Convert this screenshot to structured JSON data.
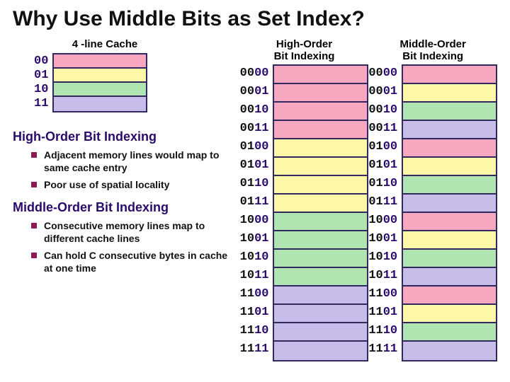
{
  "title": "Why Use Middle Bits as Set Index?",
  "cache": {
    "label": "4 -line Cache",
    "lines": [
      "00",
      "01",
      "10",
      "11"
    ],
    "colors": [
      "c0",
      "c1",
      "c2",
      "c3"
    ]
  },
  "sections": {
    "high": {
      "heading": "High-Order Bit Indexing",
      "bullets": [
        "Adjacent memory lines would map to same cache entry",
        "Poor use of spatial locality"
      ]
    },
    "middle": {
      "heading": "Middle-Order Bit Indexing",
      "bullets": [
        "Consecutive memory lines map to different cache lines",
        "Can hold C consecutive bytes in cache at one time"
      ]
    }
  },
  "columns": {
    "high": {
      "title_line1": "High-Order",
      "title_line2": "Bit Indexing",
      "rows": [
        {
          "bits": "0000",
          "hi": 2,
          "color": "c0"
        },
        {
          "bits": "0001",
          "hi": 2,
          "color": "c0"
        },
        {
          "bits": "0010",
          "hi": 2,
          "color": "c0"
        },
        {
          "bits": "0011",
          "hi": 2,
          "color": "c0"
        },
        {
          "bits": "0100",
          "hi": 2,
          "color": "c1"
        },
        {
          "bits": "0101",
          "hi": 2,
          "color": "c1"
        },
        {
          "bits": "0110",
          "hi": 2,
          "color": "c1"
        },
        {
          "bits": "0111",
          "hi": 2,
          "color": "c1"
        },
        {
          "bits": "1000",
          "hi": 2,
          "color": "c2"
        },
        {
          "bits": "1001",
          "hi": 2,
          "color": "c2"
        },
        {
          "bits": "1010",
          "hi": 2,
          "color": "c2"
        },
        {
          "bits": "1011",
          "hi": 2,
          "color": "c2"
        },
        {
          "bits": "1100",
          "hi": 2,
          "color": "c3"
        },
        {
          "bits": "1101",
          "hi": 2,
          "color": "c3"
        },
        {
          "bits": "1110",
          "hi": 2,
          "color": "c3"
        },
        {
          "bits": "1111",
          "hi": 2,
          "color": "c3"
        }
      ]
    },
    "middle": {
      "title_line1": "Middle-Order",
      "title_line2": "Bit Indexing",
      "rows": [
        {
          "bits": "0000",
          "hi": 2,
          "color": "c0"
        },
        {
          "bits": "0001",
          "hi": 2,
          "color": "c1"
        },
        {
          "bits": "0010",
          "hi": 2,
          "color": "c2"
        },
        {
          "bits": "0011",
          "hi": 2,
          "color": "c3"
        },
        {
          "bits": "0100",
          "hi": 2,
          "color": "c0"
        },
        {
          "bits": "0101",
          "hi": 2,
          "color": "c1"
        },
        {
          "bits": "0110",
          "hi": 2,
          "color": "c2"
        },
        {
          "bits": "0111",
          "hi": 2,
          "color": "c3"
        },
        {
          "bits": "1000",
          "hi": 2,
          "color": "c0"
        },
        {
          "bits": "1001",
          "hi": 2,
          "color": "c1"
        },
        {
          "bits": "1010",
          "hi": 2,
          "color": "c2"
        },
        {
          "bits": "1011",
          "hi": 2,
          "color": "c3"
        },
        {
          "bits": "1100",
          "hi": 2,
          "color": "c0"
        },
        {
          "bits": "1101",
          "hi": 2,
          "color": "c1"
        },
        {
          "bits": "1110",
          "hi": 2,
          "color": "c2"
        },
        {
          "bits": "1111",
          "hi": 2,
          "color": "c3"
        }
      ]
    }
  }
}
